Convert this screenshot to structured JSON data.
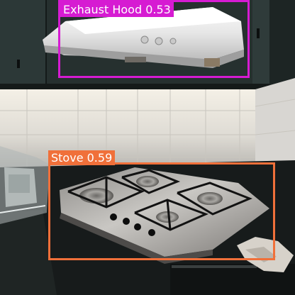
{
  "detections": [
    {
      "label": "Exhaust Hood 0.53",
      "color": "#d61bd2"
    },
    {
      "label": "Stove 0.59",
      "color": "#f0703a"
    }
  ],
  "scene": {
    "palette": {
      "wall_tile": "#e9e6df",
      "cabinet": "#24302f",
      "counter": "#161a1a",
      "steel": "#b9b8b6"
    }
  }
}
